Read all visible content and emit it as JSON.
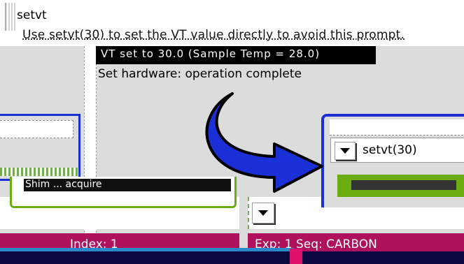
{
  "top": {
    "command": "setvt",
    "hint": "Use setvt(30) to set the VT value directly to avoid this prompt."
  },
  "titlebar": {
    "text": "VT set to 30.0 (Sample Temp = 28.0)"
  },
  "status": {
    "message": "Set hardware: operation complete"
  },
  "dropdown": {
    "value": "setvt(30)"
  },
  "green_label": {
    "text": "Shim  ...  acquire"
  },
  "footer": {
    "index_label": "Index: 1",
    "exp_seq": "Exp: 1    Seq: CARBON"
  },
  "colors": {
    "accent_blue": "#1a2fd6",
    "green": "#6cad14",
    "magenta": "#b0115c"
  }
}
